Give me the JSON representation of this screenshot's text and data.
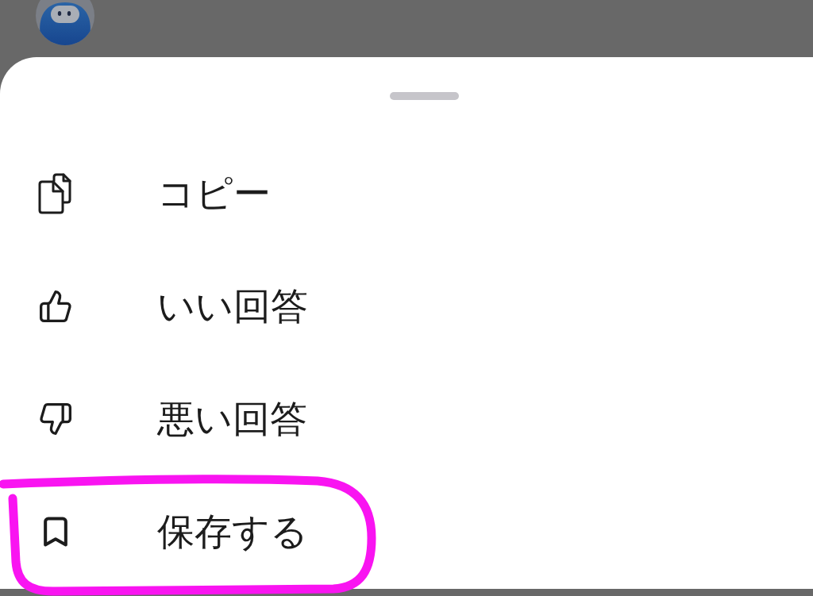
{
  "sheet": {
    "items": [
      {
        "kind": "copy",
        "label": "コピー",
        "highlighted": false
      },
      {
        "kind": "like",
        "label": "いい回答",
        "highlighted": false
      },
      {
        "kind": "dislike",
        "label": "悪い回答",
        "highlighted": false
      },
      {
        "kind": "save",
        "label": "保存する",
        "highlighted": true
      }
    ]
  }
}
